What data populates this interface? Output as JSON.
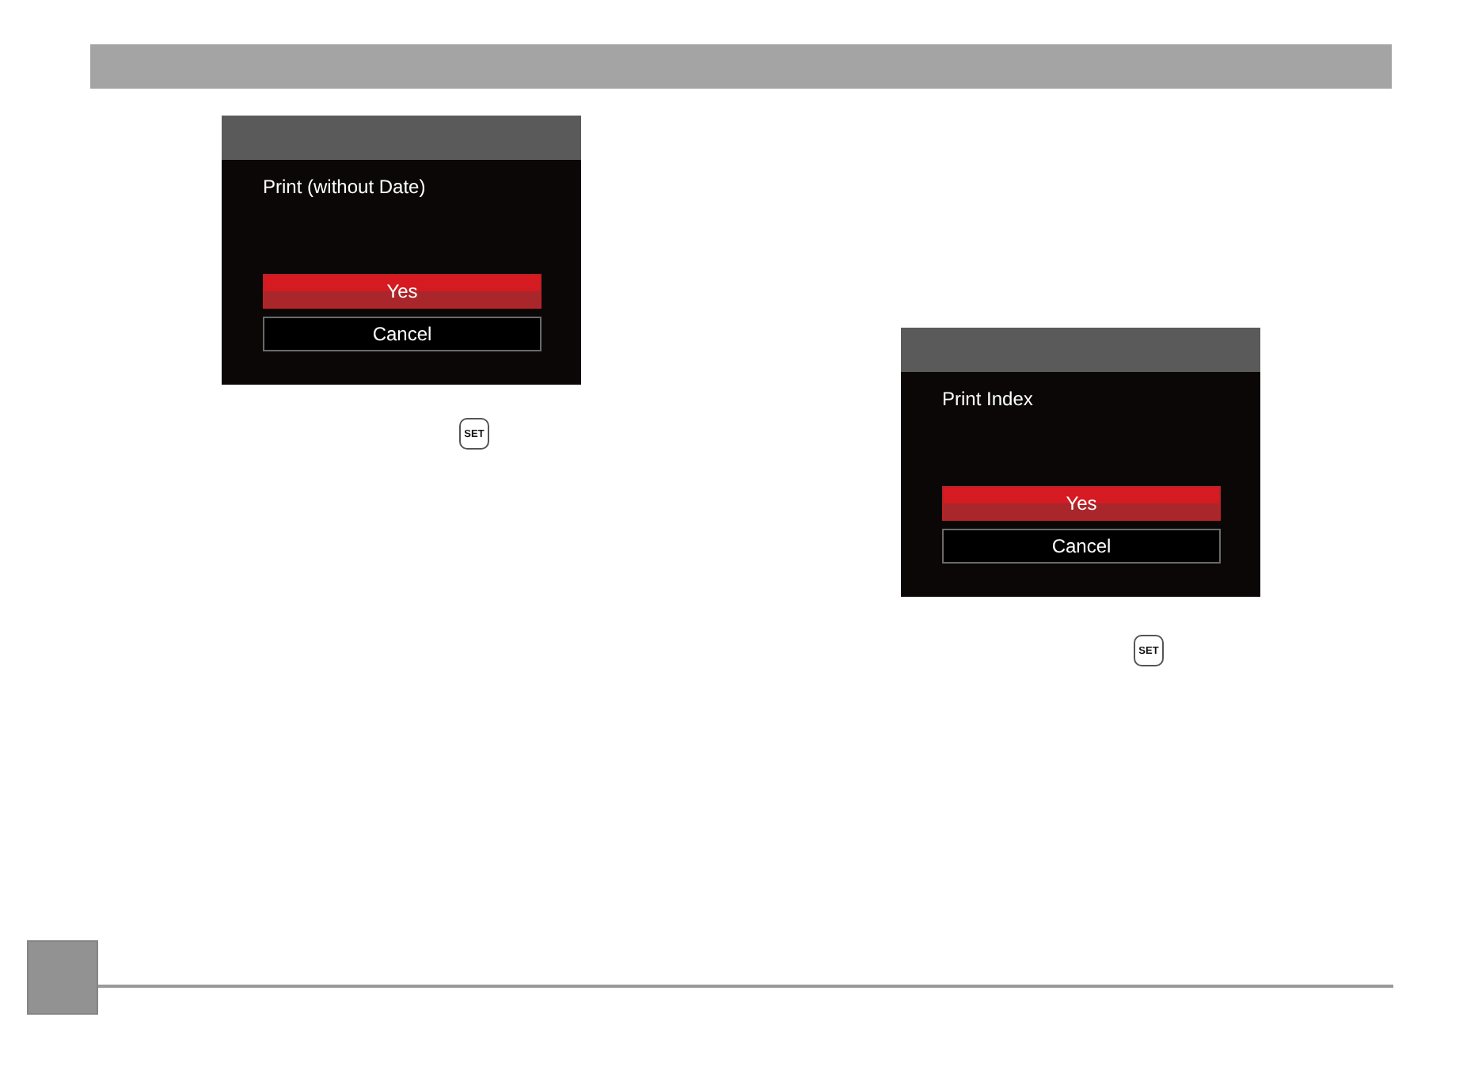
{
  "columns": [
    {
      "dialog": {
        "message": "Print (without Date)",
        "options": [
          {
            "label": "Yes",
            "selected": true
          },
          {
            "label": "Cancel",
            "selected": false
          }
        ]
      },
      "key_hint": {
        "label": "SET"
      }
    },
    {
      "dialog": {
        "message": "Print Index",
        "options": [
          {
            "label": "Yes",
            "selected": true
          },
          {
            "label": "Cancel",
            "selected": false
          }
        ]
      },
      "key_hint": {
        "label": "SET"
      }
    }
  ]
}
